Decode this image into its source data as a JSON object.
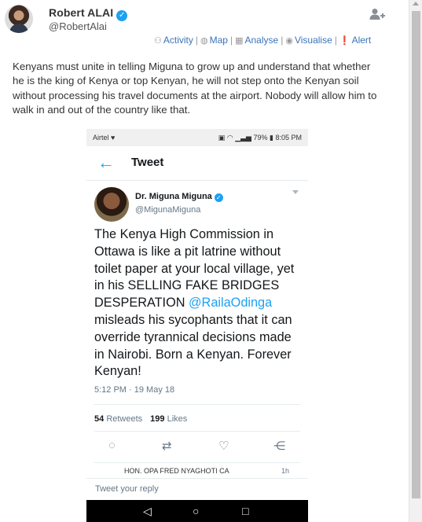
{
  "header": {
    "author_name": "Robert ALAI",
    "verified_glyph": "✓",
    "handle": "@RobertAlai",
    "follow_icon": "add-user-icon"
  },
  "actions": [
    {
      "label": "Activity",
      "icon": "person-icon",
      "glyph": "⚇"
    },
    {
      "label": "Map",
      "icon": "globe-icon",
      "glyph": "◍"
    },
    {
      "label": "Analyse",
      "icon": "table-icon",
      "glyph": "▦"
    },
    {
      "label": "Visualise",
      "icon": "eye-icon",
      "glyph": "◉"
    },
    {
      "label": "Alert",
      "icon": "exclamation-icon",
      "glyph": "❗"
    }
  ],
  "post": {
    "text": "Kenyans must unite in telling Miguna to grow up and understand that whether he is the king of Kenya or top Kenyan, he will not step onto the Kenyan soil without processing his travel documents at the airport. Nobody will allow him to walk in and out of the country like that."
  },
  "screenshot": {
    "status": {
      "carrier": "Airtel",
      "battery": "79%",
      "time": "8:05 PM"
    },
    "topbar": {
      "back_glyph": "←",
      "title": "Tweet"
    },
    "tweet": {
      "name": "Dr. Miguna Miguna",
      "handle": "@MigunaMiguna",
      "text_before": "The Kenya High Commission in Ottawa is like a pit latrine without toilet paper at your local village, yet in his SELLING FAKE BRIDGES DESPERATION ",
      "mention": "@RailaOdinga",
      "text_after": " misleads his sycophants that it can override tyrannical decisions made in Nairobi. Born a Kenyan. Forever Kenyan!",
      "timestamp": "5:12 PM · 19 May 18",
      "retweets_count": "54",
      "retweets_label": "Retweets",
      "likes_count": "199",
      "likes_label": "Likes"
    },
    "tweet_actions": [
      {
        "icon": "reply-icon",
        "glyph": "◌"
      },
      {
        "icon": "retweet-icon",
        "glyph": "⇄"
      },
      {
        "icon": "heart-icon",
        "glyph": "♡"
      },
      {
        "icon": "share-icon",
        "glyph": "⋲"
      }
    ],
    "next_item_partial": "HON. OPA FRED NYAGHOTI CA",
    "next_item_time_partial": "1h",
    "reply_placeholder": "Tweet your reply",
    "navbar": {
      "back_glyph": "◁",
      "home_glyph": "○",
      "recents_glyph": "□"
    }
  },
  "colors": {
    "link": "#3b73b9",
    "twitter_blue": "#1da1f2",
    "muted": "#657786"
  }
}
